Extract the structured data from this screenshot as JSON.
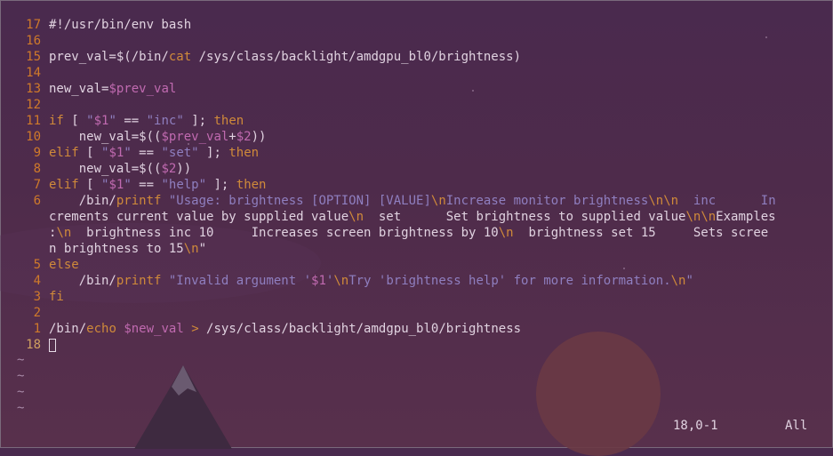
{
  "editor": {
    "lines": [
      {
        "num": "17",
        "text": "#!/usr/bin/env bash"
      },
      {
        "num": "16",
        "text": ""
      },
      {
        "num": "15",
        "text": "prev_val=$(/bin/cat /sys/class/backlight/amdgpu_bl0/brightness)"
      },
      {
        "num": "14",
        "text": ""
      },
      {
        "num": "13",
        "text": "new_val=$prev_val"
      },
      {
        "num": "12",
        "text": ""
      },
      {
        "num": "11",
        "text": "if [ \"$1\" == \"inc\" ]; then"
      },
      {
        "num": "10",
        "text": "    new_val=$(($prev_val+$2))"
      },
      {
        "num": "9",
        "text": "elif [ \"$1\" == \"set\" ]; then"
      },
      {
        "num": "8",
        "text": "    new_val=$(($2))"
      },
      {
        "num": "7",
        "text": "elif [ \"$1\" == \"help\" ]; then"
      },
      {
        "num": "6",
        "text": "    /bin/printf \"Usage: brightness [OPTION] [VALUE]\\nIncrease monitor brightness\\n\\n  inc      In"
      },
      {
        "num": "",
        "text": "crements current value by supplied value\\n  set      Set brightness to supplied value\\n\\nExamples"
      },
      {
        "num": "",
        "text": ":\\n  brightness inc 10     Increases screen brightness by 10\\n  brightness set 15     Sets scree"
      },
      {
        "num": "",
        "text": "n brightness to 15\\n\""
      },
      {
        "num": "5",
        "text": "else"
      },
      {
        "num": "4",
        "text": "    /bin/printf \"Invalid argument '$1'\\nTry 'brightness help' for more information.\\n\""
      },
      {
        "num": "3",
        "text": "fi"
      },
      {
        "num": "2",
        "text": ""
      },
      {
        "num": "1",
        "text": "/bin/echo $new_val > /sys/class/backlight/amdgpu_bl0/brightness"
      },
      {
        "num": "18",
        "text": ""
      }
    ],
    "tilde": "~"
  },
  "status": {
    "position": "18,0-1",
    "scroll": "All"
  },
  "colors": {
    "line_number": "#d07a2a",
    "keyword": "#d08a3a",
    "string": "#8f7fc0",
    "variable": "#c06ab0",
    "text": "#e0d2e0"
  }
}
